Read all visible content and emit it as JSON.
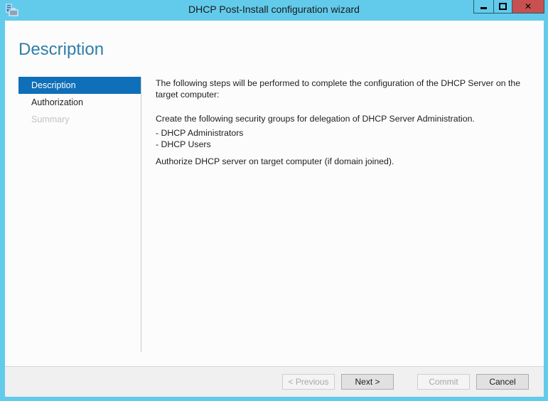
{
  "window": {
    "title": "DHCP Post-Install configuration wizard",
    "icon": "server-manager-icon",
    "controls": {
      "minimize": "minimize",
      "maximize": "maximize",
      "close": "✕"
    }
  },
  "page": {
    "title": "Description"
  },
  "nav": {
    "items": [
      {
        "label": "Description",
        "state": "active"
      },
      {
        "label": "Authorization",
        "state": "enabled"
      },
      {
        "label": "Summary",
        "state": "disabled"
      }
    ]
  },
  "content": {
    "intro": "The following steps will be performed to complete the configuration of the DHCP Server on the target computer:",
    "groups_heading": "Create the following security groups for delegation of DHCP Server Administration.",
    "groups": [
      "- DHCP Administrators",
      "- DHCP Users"
    ],
    "authorize": "Authorize DHCP server on target computer (if domain joined)."
  },
  "footer": {
    "previous": {
      "label": "< Previous",
      "enabled": false
    },
    "next": {
      "label": "Next >",
      "enabled": true
    },
    "commit": {
      "label": "Commit",
      "enabled": false
    },
    "cancel": {
      "label": "Cancel",
      "enabled": true
    }
  },
  "colors": {
    "frame": "#62cbeb",
    "accent": "#0f6fb8",
    "title_text": "#2f7ea7",
    "close_button": "#c75050"
  }
}
